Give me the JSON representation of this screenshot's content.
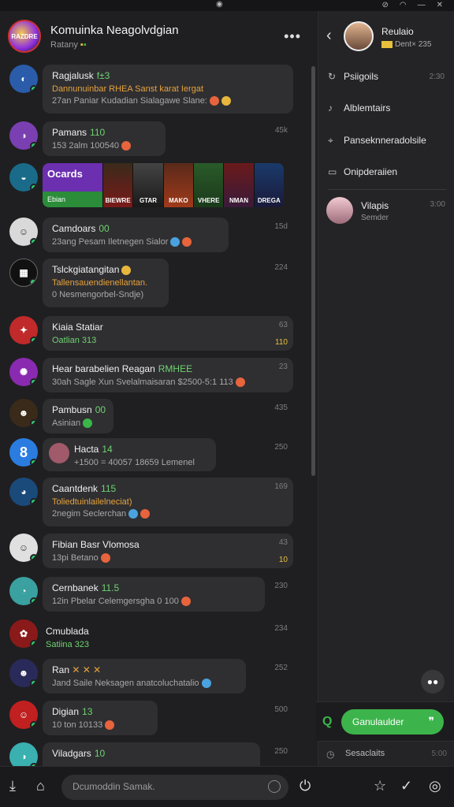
{
  "chat": {
    "title": "Komuinka Neagolvdgian",
    "subtitle": "Ratany",
    "logo_text": "RAZDRE",
    "menu_icon": "more-icon"
  },
  "messages": [
    {
      "name": "Ragjalusk",
      "tag": "f±3",
      "line2": "Dannunuinbar  RHEA  Sanst karat Iergat",
      "line3": "27an Paniar  Kudadian Sialagawe Slane:",
      "time": "",
      "color": "#2a5caa"
    },
    {
      "name": "Pamans",
      "tag": "110",
      "line2": "153 2alm  100540",
      "line3": "",
      "time": "45k",
      "color": "#7a3fb0"
    },
    {
      "name": "Ocards",
      "tag": "",
      "line2": "",
      "line3": "",
      "time": "",
      "color": "#1a6b8a"
    },
    {
      "name": "Camdoars",
      "tag": "00",
      "line2": "23ang Pesam  Iletnegen Sialor",
      "line3": "",
      "time": "15d",
      "color": "#d9d9d9"
    },
    {
      "name": "Tslckgiatangitan",
      "tag": "",
      "line2": "Tallensauendienellantan.",
      "line3": "0  Nesmengorbel-Sndje)",
      "time": "224",
      "color": "#111"
    },
    {
      "name": "Kiaia Statiar",
      "tag": "",
      "line2": "Oatlian 313",
      "line3": "",
      "time": "63",
      "time2": "110",
      "color": "#c02a2a"
    },
    {
      "name": "Hear barabelien Reagan",
      "tag": "RMHEE",
      "line2": "30ah Sagle  Xun Svelalmaisaran  $2500-5:1 113",
      "line3": "",
      "time": "23",
      "color": "#8a2ab0"
    },
    {
      "name": "Pambusn",
      "tag": "00",
      "line2": "Asinian",
      "line3": "",
      "time": "435",
      "color": "#3a2a1a"
    },
    {
      "name": "Hacta",
      "tag": "14",
      "line2": "+1500 = 40057 18659 Lemenel",
      "line3": "",
      "time": "250",
      "color": "#2a7ce0"
    },
    {
      "name": "Caantdenk",
      "tag": "115",
      "line2": "Toliedtuinlailelneciat)",
      "line3": "2negim  Seclerchan",
      "time": "169",
      "color": "#1a4a7a"
    },
    {
      "name": "Fibian Basr Vlomosa",
      "tag": "",
      "line2": "13pi Betano",
      "line3": "",
      "time": "43",
      "time2": "10",
      "color": "#e0e0e0"
    },
    {
      "name": "Cernbanek",
      "tag": "11.5",
      "line2": "12in Pbelar  Celemgersgha  0  100",
      "line3": "",
      "time": "230",
      "color": "#3aa0a0"
    },
    {
      "name": "Cmublada",
      "tag": "",
      "line2": "Satiina 323",
      "line3": "",
      "time": "234",
      "color": "#8a1a1a"
    },
    {
      "name": "Ran",
      "tag": "",
      "line2": "Jand  Saile  Neksagen anatcoluchatalio",
      "line3": "",
      "time": "252",
      "color": "#2a2a5a"
    },
    {
      "name": "Digian",
      "tag": "13",
      "line2": "10 ton  10133",
      "line3": "",
      "time": "500",
      "color": "#c02020"
    },
    {
      "name": "Viladgars",
      "tag": "10",
      "line2": "",
      "line3": "",
      "time": "250",
      "color": "#3ab0b0"
    }
  ],
  "gallery": {
    "first_title": "Ocards",
    "first_sub": "Ebian",
    "items": [
      "BIEWRE",
      "GTAR",
      "MAKO",
      "VHERE",
      "NMAN",
      "DREGA"
    ]
  },
  "composer": {
    "placeholder": "Dcumoddin Samak."
  },
  "right": {
    "contact_name": "Reulaio",
    "contact_sub": "Dent× 235",
    "menu": [
      {
        "label": "Psiigoils",
        "time": "2:30",
        "icon": "refresh-icon"
      },
      {
        "label": "Alblemtairs",
        "time": "",
        "icon": "bell-icon"
      },
      {
        "label": "Panseknneradolsile",
        "time": "",
        "icon": "tag-icon"
      },
      {
        "label": "Onipderaiien",
        "time": "",
        "icon": "folder-icon"
      }
    ],
    "contact2_name": "Vilapis",
    "contact2_sub": "Semder",
    "contact2_time": "3:00",
    "green_button": "Ganulaulder",
    "footer_label": "Sesaclaits",
    "footer_time": "5:00"
  },
  "colors": {
    "accent": "#3cb44b",
    "bubble": "#2f2f32",
    "bg": "#1c1c1e"
  }
}
